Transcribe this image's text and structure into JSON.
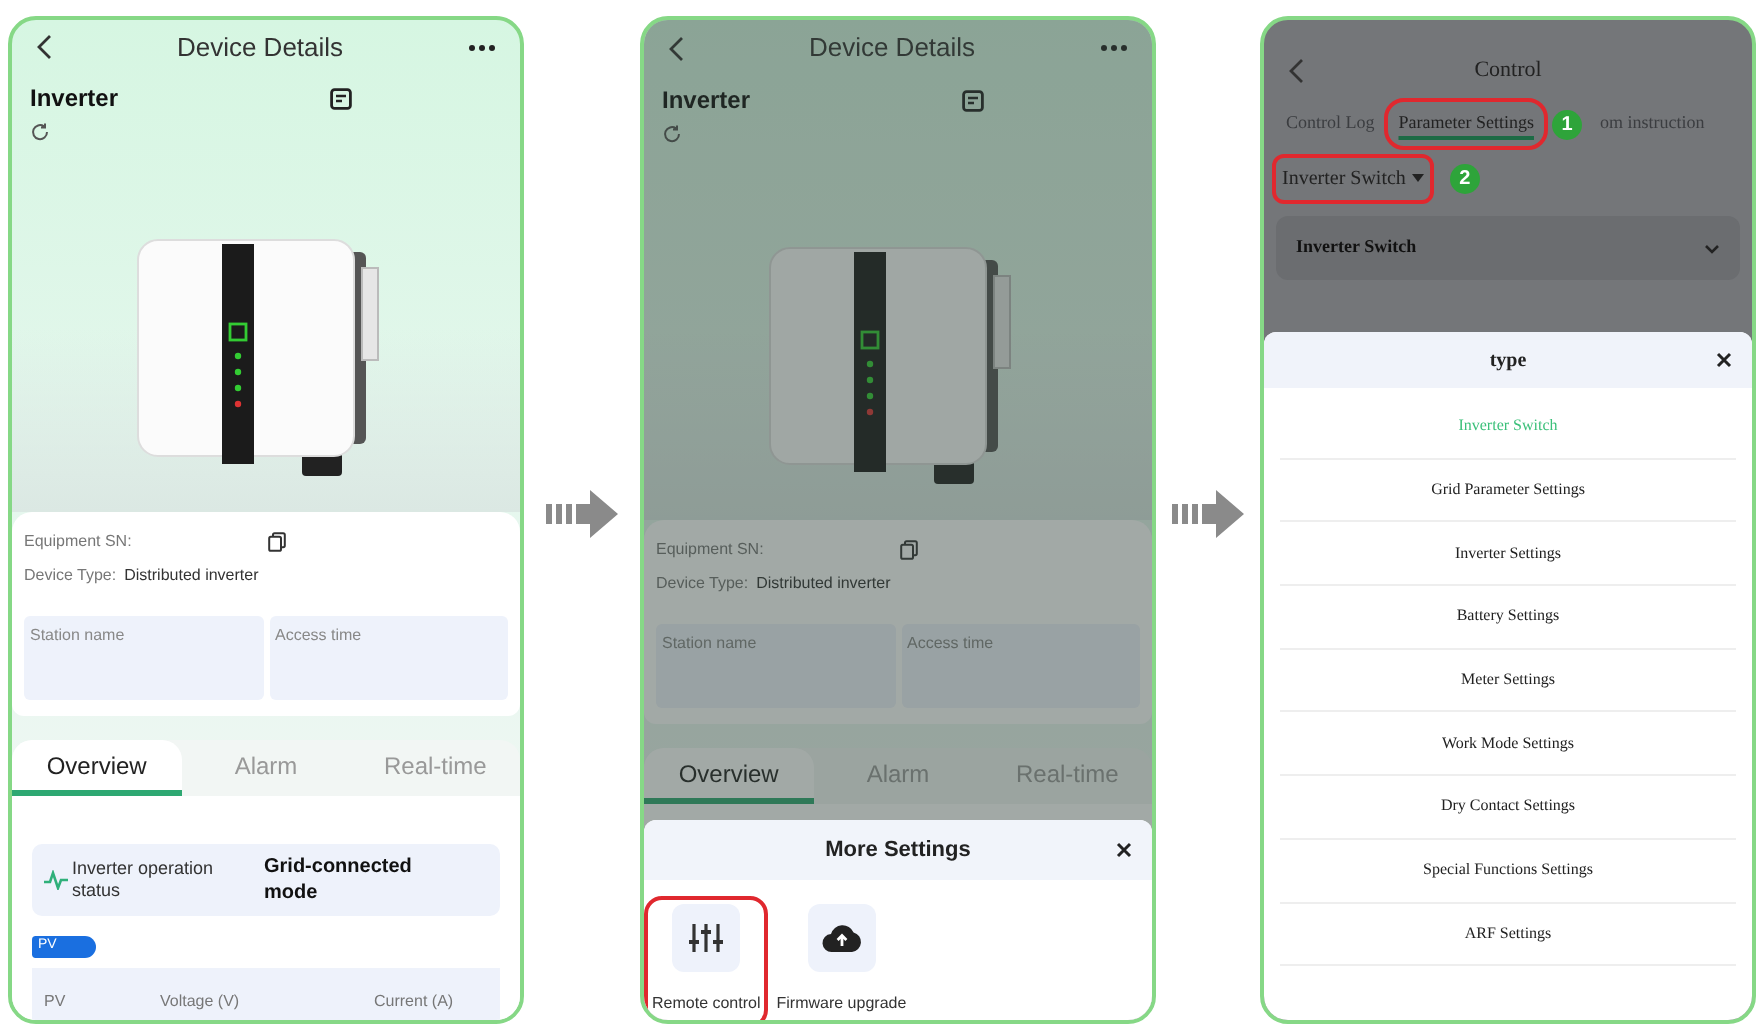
{
  "screens": [
    {
      "kind": "device",
      "dimmed": false,
      "title": "Device Details",
      "device_name": "Inverter",
      "sn_label": "Equipment SN:",
      "type_label": "Device Type:",
      "type_value": "Distributed inverter",
      "cards": [
        "Station name",
        "Access time"
      ],
      "tabs": [
        {
          "label": "Overview",
          "selected": true
        },
        {
          "label": "Alarm",
          "selected": false
        },
        {
          "label": "Real-time",
          "selected": false
        }
      ],
      "status": {
        "label": "Inverter operation status",
        "value": "Grid-connected mode"
      },
      "section_tag": "PV",
      "table_columns": [
        "PV",
        "Voltage (V)",
        "Current (A)"
      ]
    },
    {
      "kind": "device",
      "dimmed": true,
      "title": "Device Details",
      "device_name": "Inverter",
      "sn_label": "Equipment SN:",
      "type_label": "Device Type:",
      "type_value": "Distributed inverter",
      "cards": [
        "Station name",
        "Access time"
      ],
      "tabs": [
        {
          "label": "Overview",
          "selected": true
        },
        {
          "label": "Alarm",
          "selected": false
        },
        {
          "label": "Real-time",
          "selected": false
        }
      ],
      "sheet": {
        "title": "More Settings",
        "actions": [
          {
            "label": "Remote control",
            "highlighted": true
          },
          {
            "label": "Firmware upgrade",
            "highlighted": false
          }
        ]
      }
    },
    {
      "kind": "control",
      "title": "Control",
      "tabs": [
        {
          "label": "Control Log",
          "selected": false,
          "highlighted": false
        },
        {
          "label": "Parameter Settings",
          "selected": true,
          "highlighted": true,
          "step": "1"
        },
        {
          "label": "om instruction",
          "selected": false,
          "highlighted": false
        }
      ],
      "filter": {
        "label": "Inverter Switch",
        "highlighted": true,
        "step": "2"
      },
      "group": "Inverter Switch",
      "picker": {
        "title": "type",
        "options": [
          {
            "label": "Inverter Switch",
            "selected": true
          },
          {
            "label": "Grid Parameter Settings",
            "selected": false
          },
          {
            "label": "Inverter Settings",
            "selected": false
          },
          {
            "label": "Battery Settings",
            "selected": false
          },
          {
            "label": "Meter Settings",
            "selected": false
          },
          {
            "label": "Work Mode Settings",
            "selected": false
          },
          {
            "label": "Dry Contact Settings",
            "selected": false
          },
          {
            "label": "Special Functions Settings",
            "selected": false
          },
          {
            "label": "ARF Settings",
            "selected": false
          }
        ]
      }
    }
  ]
}
